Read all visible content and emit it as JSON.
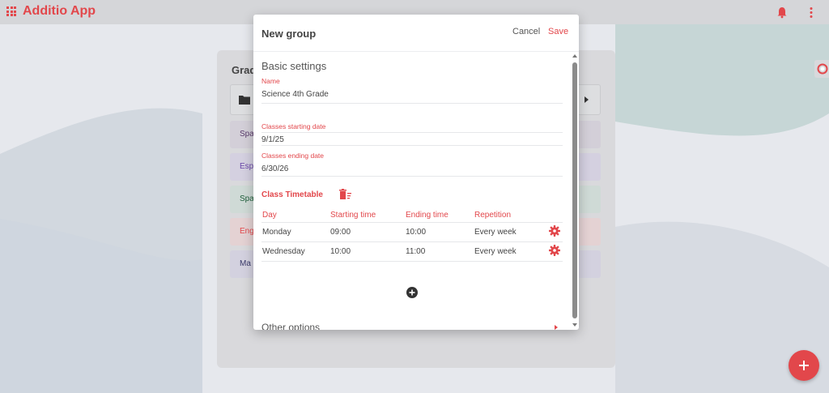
{
  "app": {
    "title": "Additio App"
  },
  "colors": {
    "accent": "#e2474b"
  },
  "background": {
    "card_title": "Grad",
    "rows": [
      {
        "label": "Spa",
        "bg": "#d3cfd8",
        "color": "#5a3b6b"
      },
      {
        "label": "Esp",
        "bg": "#d4d0e0",
        "color": "#6a47a8"
      },
      {
        "label": "Spa",
        "bg": "#cfdad6",
        "color": "#1f5f3a"
      },
      {
        "label": "Eng",
        "bg": "#e4d2d3",
        "color": "#e2474b"
      },
      {
        "label": "Ma",
        "bg": "#d3d1df",
        "color": "#3a3a6a"
      }
    ]
  },
  "modal": {
    "title": "New group",
    "cancel_label": "Cancel",
    "save_label": "Save",
    "basic_settings": "Basic settings",
    "fields": {
      "name_label": "Name",
      "name_value": "Science 4th Grade",
      "start_label": "Classes starting date",
      "start_value": "9/1/25",
      "end_label": "Classes ending date",
      "end_value": "6/30/26"
    },
    "timetable": {
      "title": "Class Timetable",
      "headers": [
        "Day",
        "Starting time",
        "Ending time",
        "Repetition"
      ],
      "rows": [
        [
          "Monday",
          "09:00",
          "10:00",
          "Every week"
        ],
        [
          "Wednesday",
          "10:00",
          "11:00",
          "Every week"
        ]
      ]
    },
    "other_options": "Other options"
  },
  "icons": {
    "apps": "grid-apps-icon",
    "bell": "bell-icon",
    "more": "more-vertical-icon",
    "trash": "delete-timetable-icon",
    "gear": "gear-icon",
    "add": "add-circle-icon",
    "fab": "plus-icon"
  }
}
